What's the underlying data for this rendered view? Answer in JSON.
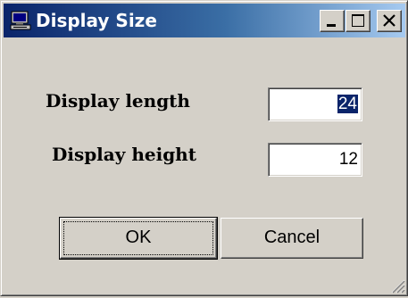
{
  "window": {
    "title": "Display Size",
    "title_icon": "computer-icon",
    "controls": {
      "minimize_icon": "minimize-icon",
      "maximize_icon": "maximize-icon",
      "close_icon": "close-icon"
    }
  },
  "form": {
    "length_label": "Display length",
    "length_value": "24",
    "height_label": "Display height",
    "height_value": "12"
  },
  "buttons": {
    "ok_label": "OK",
    "cancel_label": "Cancel"
  },
  "colors": {
    "titlebar_start": "#0a246a",
    "titlebar_end": "#a6caf0",
    "window_face": "#d4d0c8",
    "selection": "#0a246a"
  }
}
